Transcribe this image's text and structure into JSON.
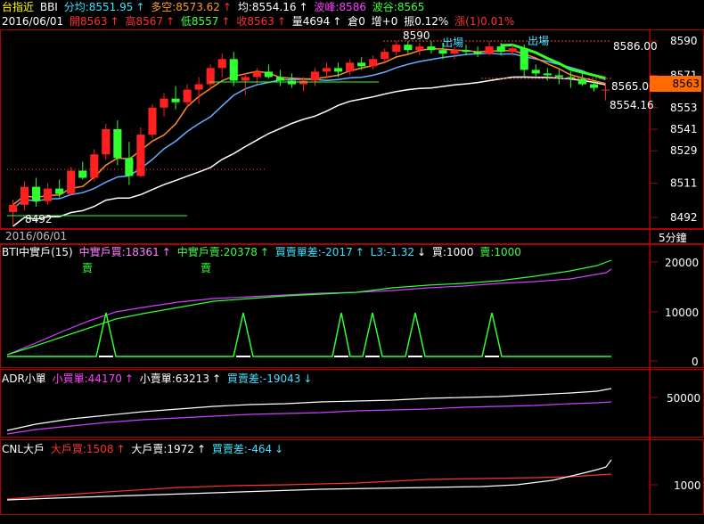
{
  "header": {
    "title": "台指近",
    "indicator": "BBI",
    "fen_jun": "分均:8551.95",
    "duo_kong": "多空:8573.62",
    "jun": "均:8554.16",
    "bo_feng": "波峰:8586",
    "bo_gu": "波谷:8565"
  },
  "quote": {
    "date": "2016/06/01",
    "open": "開8563",
    "high": "高8567",
    "low": "低8557",
    "close": "收8563",
    "volume": "量4694",
    "oi": "倉0",
    "oi_change": "增+0",
    "amplitude": "振0.12%",
    "change": "漲(1)0.01%"
  },
  "main_chart": {
    "y_ticks": [
      "8590",
      "8571",
      "8553",
      "8541",
      "8529",
      "8511",
      "8492"
    ],
    "annotations": {
      "peak": "8590",
      "trough": "8492",
      "exit1": "出場",
      "exit2": "出場",
      "level_high": "8586.00",
      "level_current": "8565.00",
      "level_avg": "8554.16"
    },
    "current_price": "8563",
    "date_label": "2016/06/01",
    "period": "5分鐘"
  },
  "bti": {
    "label": "BTI中實戶(15)",
    "buy": "中實戶買:18361",
    "sell": "中實戶賣:20378",
    "diff": "買賣單差:-2017",
    "l3": "L3:-1.32",
    "b": "買:1000",
    "s": "賣:1000",
    "sig1": "賣",
    "sig2": "賣",
    "y_ticks": [
      "20000",
      "10000",
      "0"
    ]
  },
  "adr": {
    "label": "ADR小單",
    "buy": "小買單:44170",
    "sell": "小賣單:63213",
    "diff": "買賣差:-19043",
    "y_ticks": [
      "50000"
    ]
  },
  "cnl": {
    "label": "CNL大戶",
    "buy": "大戶買:1508",
    "sell": "大戶賣:1972",
    "diff": "買賣差:-464",
    "y_ticks": [
      "1000"
    ]
  },
  "colors": {
    "bull": "#ff2020",
    "bear": "#30ff30",
    "ma_fast": "#ff8c28",
    "ma_mid": "#60b0ff",
    "ma_slow": "#ffffff",
    "bbi": "#30ff30",
    "grid": "#b00000"
  },
  "chart_data": {
    "type": "candlestick",
    "ylim": [
      8488,
      8595
    ],
    "candles": [
      {
        "o": 8495,
        "h": 8502,
        "l": 8488,
        "c": 8499
      },
      {
        "o": 8499,
        "h": 8512,
        "l": 8496,
        "c": 8509
      },
      {
        "o": 8509,
        "h": 8514,
        "l": 8498,
        "c": 8501
      },
      {
        "o": 8501,
        "h": 8511,
        "l": 8499,
        "c": 8508
      },
      {
        "o": 8508,
        "h": 8513,
        "l": 8503,
        "c": 8505
      },
      {
        "o": 8505,
        "h": 8520,
        "l": 8504,
        "c": 8518
      },
      {
        "o": 8518,
        "h": 8523,
        "l": 8513,
        "c": 8514
      },
      {
        "o": 8514,
        "h": 8530,
        "l": 8512,
        "c": 8527
      },
      {
        "o": 8527,
        "h": 8544,
        "l": 8524,
        "c": 8541
      },
      {
        "o": 8541,
        "h": 8546,
        "l": 8521,
        "c": 8525
      },
      {
        "o": 8525,
        "h": 8534,
        "l": 8510,
        "c": 8515
      },
      {
        "o": 8515,
        "h": 8542,
        "l": 8514,
        "c": 8538
      },
      {
        "o": 8538,
        "h": 8555,
        "l": 8536,
        "c": 8553
      },
      {
        "o": 8553,
        "h": 8561,
        "l": 8548,
        "c": 8558
      },
      {
        "o": 8558,
        "h": 8565,
        "l": 8552,
        "c": 8556
      },
      {
        "o": 8556,
        "h": 8566,
        "l": 8553,
        "c": 8563
      },
      {
        "o": 8563,
        "h": 8570,
        "l": 8555,
        "c": 8566
      },
      {
        "o": 8566,
        "h": 8577,
        "l": 8563,
        "c": 8575
      },
      {
        "o": 8575,
        "h": 8583,
        "l": 8570,
        "c": 8580
      },
      {
        "o": 8580,
        "h": 8584,
        "l": 8565,
        "c": 8568
      },
      {
        "o": 8568,
        "h": 8572,
        "l": 8560,
        "c": 8570
      },
      {
        "o": 8570,
        "h": 8575,
        "l": 8566,
        "c": 8573
      },
      {
        "o": 8573,
        "h": 8577,
        "l": 8569,
        "c": 8570
      },
      {
        "o": 8570,
        "h": 8574,
        "l": 8565,
        "c": 8568
      },
      {
        "o": 8568,
        "h": 8572,
        "l": 8564,
        "c": 8566
      },
      {
        "o": 8566,
        "h": 8570,
        "l": 8562,
        "c": 8568
      },
      {
        "o": 8568,
        "h": 8575,
        "l": 8565,
        "c": 8573
      },
      {
        "o": 8573,
        "h": 8578,
        "l": 8569,
        "c": 8575
      },
      {
        "o": 8575,
        "h": 8578,
        "l": 8570,
        "c": 8573
      },
      {
        "o": 8573,
        "h": 8580,
        "l": 8571,
        "c": 8578
      },
      {
        "o": 8578,
        "h": 8581,
        "l": 8574,
        "c": 8576
      },
      {
        "o": 8576,
        "h": 8582,
        "l": 8574,
        "c": 8580
      },
      {
        "o": 8580,
        "h": 8586,
        "l": 8578,
        "c": 8584
      },
      {
        "o": 8584,
        "h": 8590,
        "l": 8582,
        "c": 8588
      },
      {
        "o": 8588,
        "h": 8590,
        "l": 8583,
        "c": 8585
      },
      {
        "o": 8585,
        "h": 8589,
        "l": 8582,
        "c": 8587
      },
      {
        "o": 8587,
        "h": 8590,
        "l": 8583,
        "c": 8585
      },
      {
        "o": 8585,
        "h": 8589,
        "l": 8580,
        "c": 8583
      },
      {
        "o": 8583,
        "h": 8587,
        "l": 8580,
        "c": 8585
      },
      {
        "o": 8585,
        "h": 8588,
        "l": 8582,
        "c": 8584
      },
      {
        "o": 8584,
        "h": 8587,
        "l": 8581,
        "c": 8583
      },
      {
        "o": 8583,
        "h": 8590,
        "l": 8582,
        "c": 8587
      },
      {
        "o": 8587,
        "h": 8589,
        "l": 8582,
        "c": 8584
      },
      {
        "o": 8584,
        "h": 8588,
        "l": 8582,
        "c": 8586
      },
      {
        "o": 8586,
        "h": 8588,
        "l": 8570,
        "c": 8574
      },
      {
        "o": 8574,
        "h": 8577,
        "l": 8569,
        "c": 8572
      },
      {
        "o": 8572,
        "h": 8575,
        "l": 8568,
        "c": 8571
      },
      {
        "o": 8571,
        "h": 8574,
        "l": 8566,
        "c": 8570
      },
      {
        "o": 8570,
        "h": 8573,
        "l": 8564,
        "c": 8569
      },
      {
        "o": 8569,
        "h": 8572,
        "l": 8565,
        "c": 8566
      },
      {
        "o": 8566,
        "h": 8568,
        "l": 8562,
        "c": 8564
      },
      {
        "o": 8563,
        "h": 8567,
        "l": 8557,
        "c": 8563
      }
    ]
  }
}
